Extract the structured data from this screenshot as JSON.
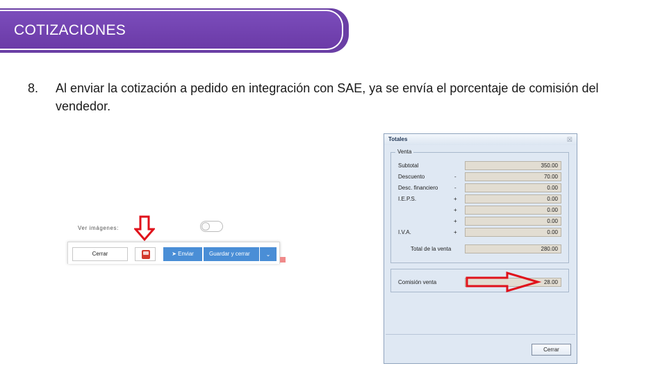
{
  "header": {
    "title": "COTIZACIONES"
  },
  "content": {
    "item_number": "8.",
    "item_text": "Al enviar la cotización a pedido en integración con SAE, ya se envía el porcentaje de comisión del vendedor."
  },
  "left_screenshot": {
    "ver_imagenes_label": "Ver imágenes:",
    "cerrar_label": "Cerrar",
    "enviar_label": "Enviar",
    "guardar_label": "Guardar y cerrar",
    "dropdown_glyph": "⌄"
  },
  "dialog": {
    "title": "Totales",
    "close_glyph": "☒",
    "venta_legend": "Venta",
    "rows": [
      {
        "label": "Subtotal",
        "sign": "",
        "value": "350.00"
      },
      {
        "label": "Descuento",
        "sign": "-",
        "value": "70.00"
      },
      {
        "label": "Desc. financiero",
        "sign": "-",
        "value": "0.00"
      },
      {
        "label": "I.E.P.S.",
        "sign": "+",
        "value": "0.00"
      },
      {
        "label": "",
        "sign": "+",
        "value": "0.00"
      },
      {
        "label": "",
        "sign": "+",
        "value": "0.00"
      },
      {
        "label": "I.V.A.",
        "sign": "+",
        "value": "0.00"
      }
    ],
    "total_label": "Total de la venta",
    "total_value": "280.00",
    "comision_label": "Comisión venta",
    "comision_value": "28.00",
    "cerrar_label": "Cerrar"
  },
  "colors": {
    "banner": "#6b3aa7",
    "accent_blue": "#4a8ed6",
    "arrow_red": "#e0121b"
  }
}
